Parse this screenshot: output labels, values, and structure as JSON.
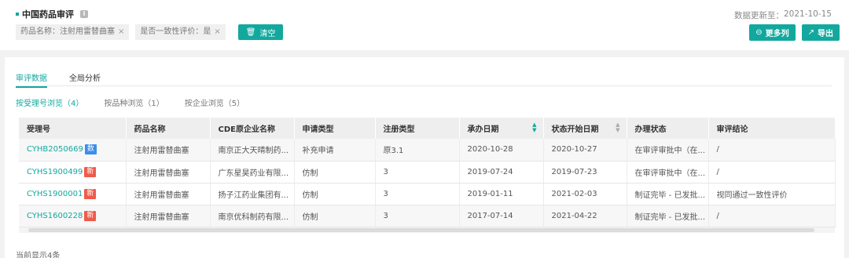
{
  "header": {
    "title": "中国药品审评",
    "info_icon": "i",
    "update_label": "数据更新至：",
    "update_date": "2021-10-15",
    "filters": [
      {
        "label": "药品名称：注射用雷替曲塞",
        "close": "×"
      },
      {
        "label": "是否一致性评价：是",
        "close": "×"
      }
    ],
    "clear_label": "清空",
    "clear_icon": "trash-icon",
    "more_columns_label": "更多列",
    "export_label": "导出",
    "accent_color": "#13a89e"
  },
  "tabs": [
    {
      "label": "审评数据",
      "active": true
    },
    {
      "label": "全局分析",
      "active": false
    }
  ],
  "subtabs": [
    {
      "label": "按受理号浏览（4）",
      "active": true
    },
    {
      "label": "按品种浏览（1）",
      "active": false
    },
    {
      "label": "按企业浏览（5）",
      "active": false
    }
  ],
  "table": {
    "columns": [
      "受理号",
      "药品名称",
      "CDE原企业名称",
      "申请类型",
      "注册类型",
      "承办日期",
      "状态开始日期",
      "办理状态",
      "审评结论"
    ],
    "rows": [
      {
        "id": "CYHB2050669",
        "badge": "数",
        "badge_color": "blue",
        "drug": "注射用雷替曲塞",
        "company": "南京正大天晴制药...",
        "apply": "补充申请",
        "reg": "原3.1",
        "date1": "2020-10-28",
        "date2": "2020-10-27",
        "status": "在审评审批中（在...",
        "result": "/"
      },
      {
        "id": "CYHS1900499",
        "badge": "新",
        "badge_color": "red",
        "drug": "注射用雷替曲塞",
        "company": "广东星昊药业有限...",
        "apply": "仿制",
        "reg": "3",
        "date1": "2019-07-24",
        "date2": "2019-07-23",
        "status": "在审评审批中（在...",
        "result": "/"
      },
      {
        "id": "CYHS1900001",
        "badge": "新",
        "badge_color": "red",
        "drug": "注射用雷替曲塞",
        "company": "扬子江药业集团有...",
        "apply": "仿制",
        "reg": "3",
        "date1": "2019-01-11",
        "date2": "2021-02-03",
        "status": "制证完毕 - 已发批...",
        "result": "视同通过一致性评价"
      },
      {
        "id": "CYHS1600228",
        "badge": "新",
        "badge_color": "red",
        "drug": "注射用雷替曲塞",
        "company": "南京优科制药有限...",
        "apply": "仿制",
        "reg": "3",
        "date1": "2017-07-14",
        "date2": "2021-04-22",
        "status": "制证完毕 - 已发批...",
        "result": "/"
      }
    ]
  },
  "footer": "当前显示4条"
}
